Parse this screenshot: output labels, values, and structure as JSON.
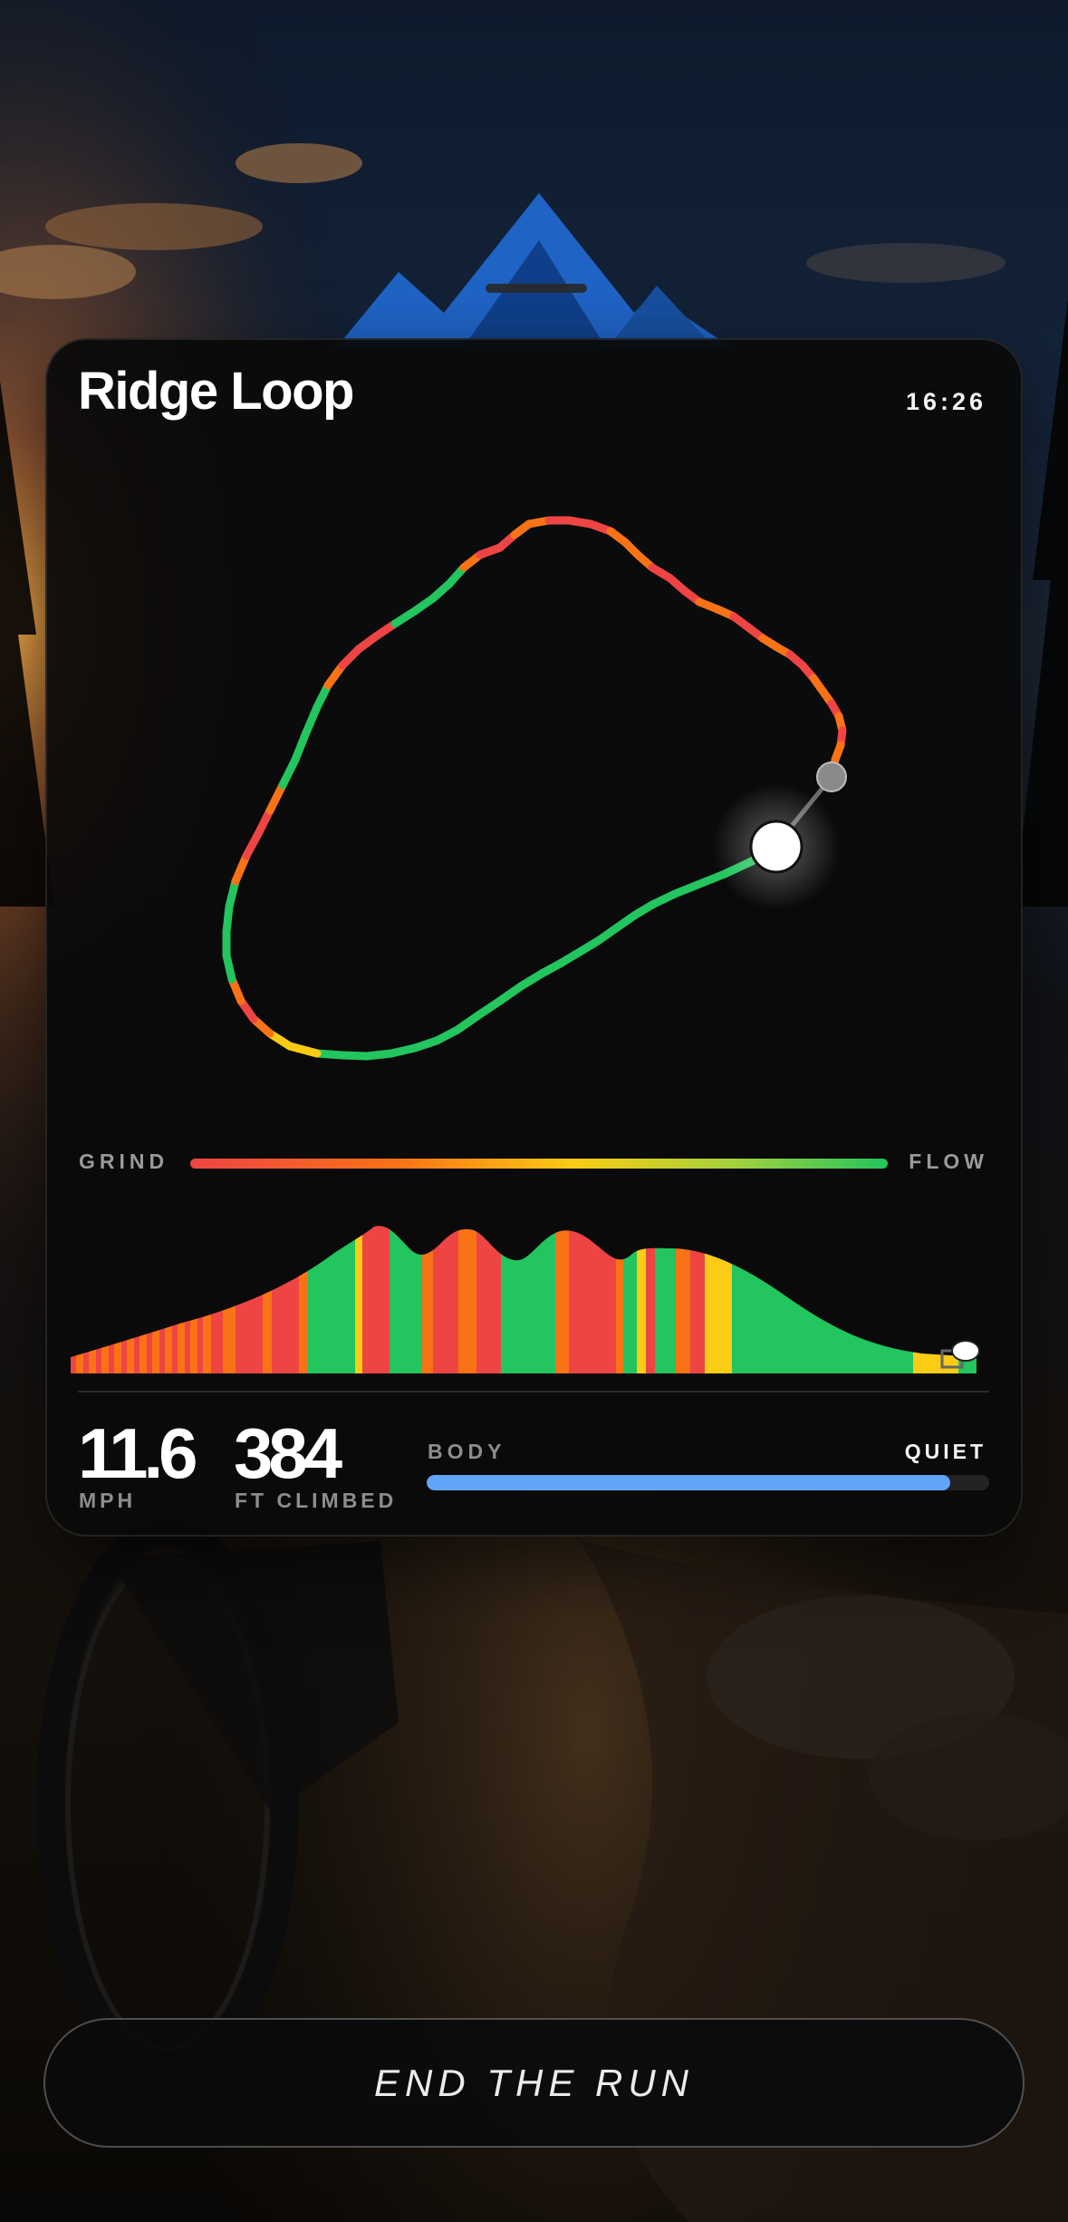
{
  "route": {
    "title": "Ridge Loop",
    "clock": "16:26"
  },
  "legend": {
    "left_label": "GRIND",
    "right_label": "FLOW",
    "colors": [
      "#ef4444",
      "#f97316",
      "#facc15",
      "#22c55e"
    ]
  },
  "stats": {
    "speed_value": "11.6",
    "speed_unit": "MPH",
    "climb_value": "384",
    "climb_unit": "FT CLIMBED"
  },
  "body": {
    "label": "BODY",
    "state": "QUIET",
    "level": 0.93,
    "color": "#60a5fa"
  },
  "actions": {
    "end_label": "END THE RUN"
  },
  "icons": {
    "logo": "mountain-logo-icon",
    "rider_marker": "current-position-marker",
    "start_marker": "start-point-marker"
  },
  "palette": {
    "grind": "#ef4444",
    "push": "#f97316",
    "steady": "#facc15",
    "flow": "#22c55e"
  }
}
